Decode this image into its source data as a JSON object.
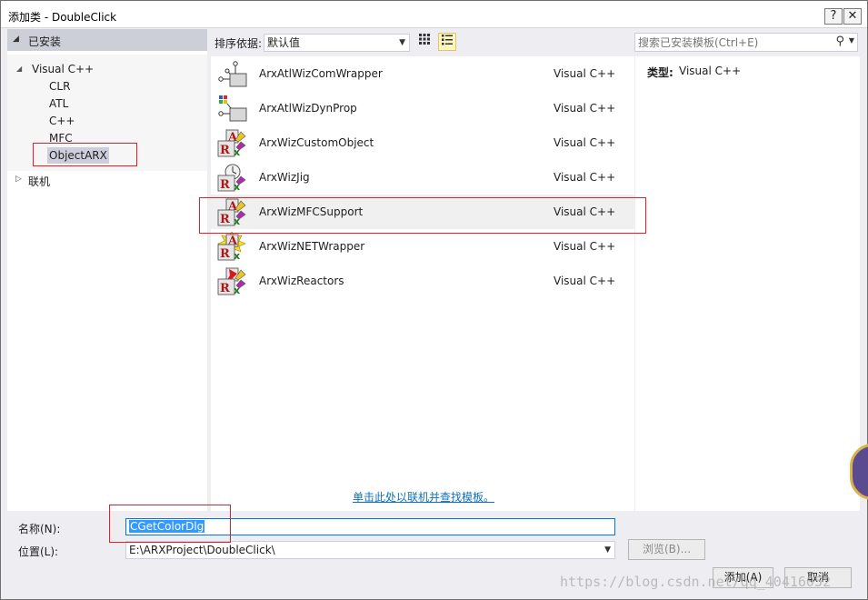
{
  "window": {
    "title": "添加类 - DoubleClick",
    "help_btn": "?",
    "close_btn": "✕"
  },
  "sidebar": {
    "installed": "已安装",
    "tree": {
      "root": "Visual C++",
      "children": [
        "CLR",
        "ATL",
        "C++",
        "MFC",
        "ObjectARX"
      ],
      "selected": "ObjectARX"
    },
    "online": "联机"
  },
  "toolbar": {
    "sort_label": "排序依据:",
    "sort_value": "默认值",
    "search_placeholder": "搜索已安装模板(Ctrl+E)"
  },
  "templates": [
    {
      "name": "ArxAtlWizComWrapper",
      "lang": "Visual C++",
      "icon": "com-wrapper-icon"
    },
    {
      "name": "ArxAtlWizDynProp",
      "lang": "Visual C++",
      "icon": "dyn-prop-icon"
    },
    {
      "name": "ArxWizCustomObject",
      "lang": "Visual C++",
      "icon": "arx-wizard-icon"
    },
    {
      "name": "ArxWizJig",
      "lang": "Visual C++",
      "icon": "arx-jig-icon"
    },
    {
      "name": "ArxWizMFCSupport",
      "lang": "Visual C++",
      "icon": "arx-wizard-icon"
    },
    {
      "name": "ArxWizNETWrapper",
      "lang": "Visual C++",
      "icon": "arx-net-icon"
    },
    {
      "name": "ArxWizReactors",
      "lang": "Visual C++",
      "icon": "arx-reactor-icon"
    }
  ],
  "selected_template": "ArxWizMFCSupport",
  "online_link": "单击此处以联机并查找模板。",
  "details": {
    "type_label": "类型:",
    "type_value": "Visual C++"
  },
  "form": {
    "name_label": "名称(N):",
    "name_value": "CGetColorDlg",
    "location_label": "位置(L):",
    "location_value": "E:\\ARXProject\\DoubleClick\\",
    "browse": "浏览(B)...",
    "add": "添加(A)",
    "cancel": "取消"
  },
  "watermark": "https://blog.csdn.net/qq_40416052",
  "colors": {
    "accent": "#007acc",
    "annotation": "#e0202a",
    "link": "#0e70c0",
    "selection": "#cccedb"
  }
}
